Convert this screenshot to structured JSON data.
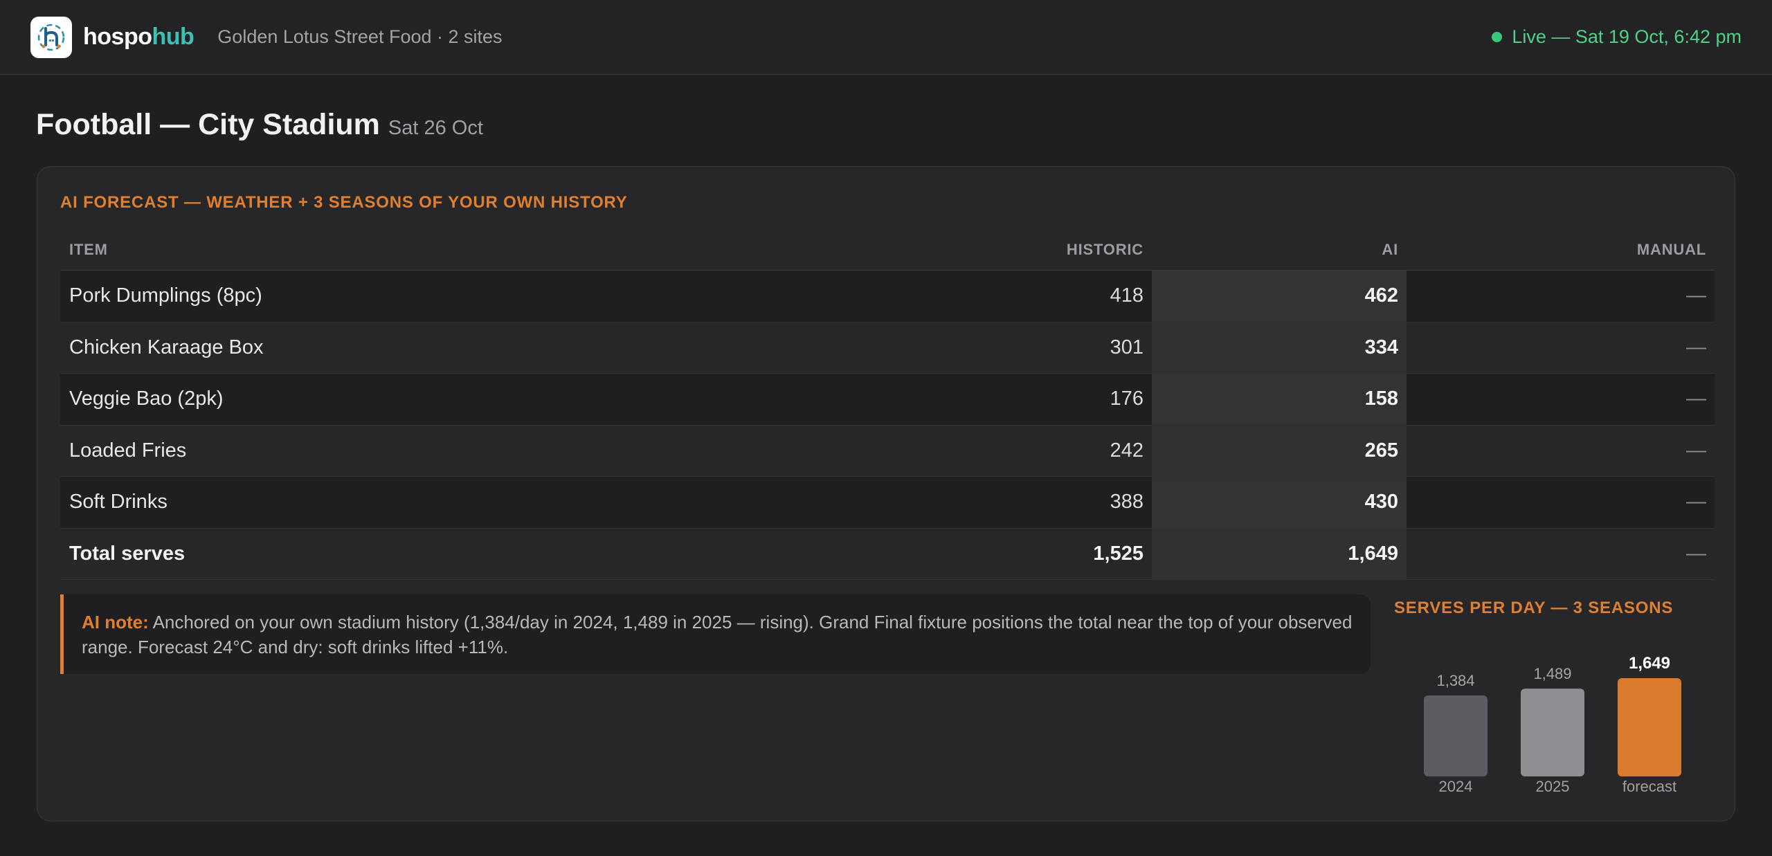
{
  "header": {
    "brand_part1": "hospo",
    "brand_part2": "hub",
    "org": "Golden Lotus Street Food · 2 sites",
    "live_status": "Live — Sat 19 Oct, 6:42 pm",
    "logo_icon": "hospohub-logo-icon"
  },
  "page": {
    "title": "Football — City Stadium",
    "date": "Sat 26 Oct"
  },
  "forecast": {
    "label": "AI FORECAST — WEATHER + 3 SEASONS OF YOUR OWN HISTORY",
    "columns": {
      "item": "ITEM",
      "historic": "HISTORIC",
      "ai": "AI",
      "manual": "MANUAL"
    },
    "rows": [
      {
        "item": "Pork Dumplings (8pc)",
        "historic": "418",
        "ai": "462",
        "manual": "—"
      },
      {
        "item": "Chicken Karaage Box",
        "historic": "301",
        "ai": "334",
        "manual": "—"
      },
      {
        "item": "Veggie Bao (2pk)",
        "historic": "176",
        "ai": "158",
        "manual": "—"
      },
      {
        "item": "Loaded Fries",
        "historic": "242",
        "ai": "265",
        "manual": "—"
      },
      {
        "item": "Soft Drinks",
        "historic": "388",
        "ai": "430",
        "manual": "—"
      }
    ],
    "total": {
      "item": "Total serves",
      "historic": "1,525",
      "ai": "1,649",
      "manual": "—"
    }
  },
  "note": {
    "label": "AI note:",
    "text": "Anchored on your own stadium history (1,384/day in 2024, 1,489 in 2025 — rising). Grand Final fixture positions the total near the top of your observed range. Forecast 24°C and dry: soft drinks lifted +11%."
  },
  "chart_data": {
    "type": "bar",
    "title": "SERVES PER DAY — 3 SEASONS",
    "categories": [
      "2024",
      "2025",
      "forecast"
    ],
    "values": [
      1384,
      1489,
      1649
    ],
    "value_labels": [
      "1,384",
      "1,489",
      "1,649"
    ],
    "colors": [
      "#5b5b62",
      "#8e8e93",
      "#d97a2c"
    ],
    "label_colors": [
      "#a6a6ab",
      "#a6a6ab",
      "#ffffff"
    ]
  }
}
